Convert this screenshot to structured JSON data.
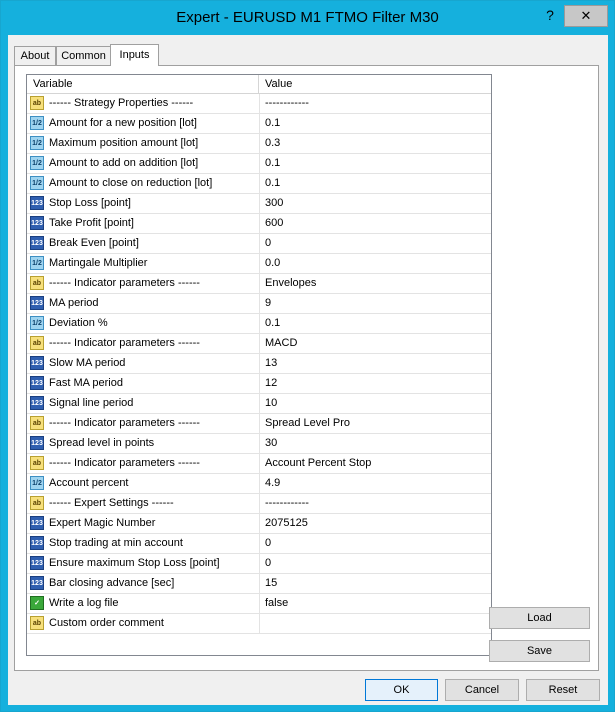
{
  "window": {
    "title": "Expert - EURUSD M1 FTMO Filter M30",
    "help_label": "?",
    "close_label": "✕"
  },
  "tabs": [
    {
      "label": "About"
    },
    {
      "label": "Common"
    },
    {
      "label": "Inputs"
    }
  ],
  "grid": {
    "headers": {
      "variable": "Variable",
      "value": "Value"
    },
    "rows": [
      {
        "type": "ab",
        "icon": "ab",
        "name": "------ Strategy Properties ------",
        "value": "------------"
      },
      {
        "type": "dbl",
        "icon": "1/2",
        "name": "Amount for a new position [lot]",
        "value": "0.1"
      },
      {
        "type": "dbl",
        "icon": "1/2",
        "name": "Maximum position amount [lot]",
        "value": "0.3"
      },
      {
        "type": "dbl",
        "icon": "1/2",
        "name": "Amount to add on addition [lot]",
        "value": "0.1"
      },
      {
        "type": "dbl",
        "icon": "1/2",
        "name": "Amount to close on reduction [lot]",
        "value": "0.1"
      },
      {
        "type": "int",
        "icon": "123",
        "name": "Stop Loss [point]",
        "value": "300"
      },
      {
        "type": "int",
        "icon": "123",
        "name": "Take Profit [point]",
        "value": "600"
      },
      {
        "type": "int",
        "icon": "123",
        "name": "Break Even [point]",
        "value": "0"
      },
      {
        "type": "dbl",
        "icon": "1/2",
        "name": "Martingale Multiplier",
        "value": "0.0"
      },
      {
        "type": "ab",
        "icon": "ab",
        "name": "------ Indicator parameters ------",
        "value": "Envelopes"
      },
      {
        "type": "int",
        "icon": "123",
        "name": "MA period",
        "value": "9"
      },
      {
        "type": "dbl",
        "icon": "1/2",
        "name": "Deviation %",
        "value": "0.1"
      },
      {
        "type": "ab",
        "icon": "ab",
        "name": "------ Indicator parameters ------",
        "value": "MACD"
      },
      {
        "type": "int",
        "icon": "123",
        "name": "Slow MA period",
        "value": "13"
      },
      {
        "type": "int",
        "icon": "123",
        "name": "Fast MA period",
        "value": "12"
      },
      {
        "type": "int",
        "icon": "123",
        "name": "Signal line period",
        "value": "10"
      },
      {
        "type": "ab",
        "icon": "ab",
        "name": "------ Indicator parameters ------",
        "value": "Spread Level Pro"
      },
      {
        "type": "int",
        "icon": "123",
        "name": "Spread level in points",
        "value": "30"
      },
      {
        "type": "ab",
        "icon": "ab",
        "name": "------ Indicator parameters ------",
        "value": "Account Percent Stop"
      },
      {
        "type": "dbl",
        "icon": "1/2",
        "name": "Account percent",
        "value": "4.9"
      },
      {
        "type": "ab",
        "icon": "ab",
        "name": "------ Expert Settings ------",
        "value": "------------"
      },
      {
        "type": "int",
        "icon": "123",
        "name": "Expert Magic Number",
        "value": "2075125"
      },
      {
        "type": "int",
        "icon": "123",
        "name": "Stop trading at min account",
        "value": "0"
      },
      {
        "type": "int",
        "icon": "123",
        "name": "Ensure maximum Stop Loss [point]",
        "value": "0"
      },
      {
        "type": "int",
        "icon": "123",
        "name": "Bar closing advance [sec]",
        "value": "15"
      },
      {
        "type": "bool",
        "icon": "✓",
        "name": "Write a log file",
        "value": "false"
      },
      {
        "type": "ab",
        "icon": "ab",
        "name": "Custom order comment",
        "value": ""
      }
    ]
  },
  "side_buttons": {
    "load": "Load",
    "save": "Save"
  },
  "footer": {
    "ok": "OK",
    "cancel": "Cancel",
    "reset": "Reset"
  }
}
